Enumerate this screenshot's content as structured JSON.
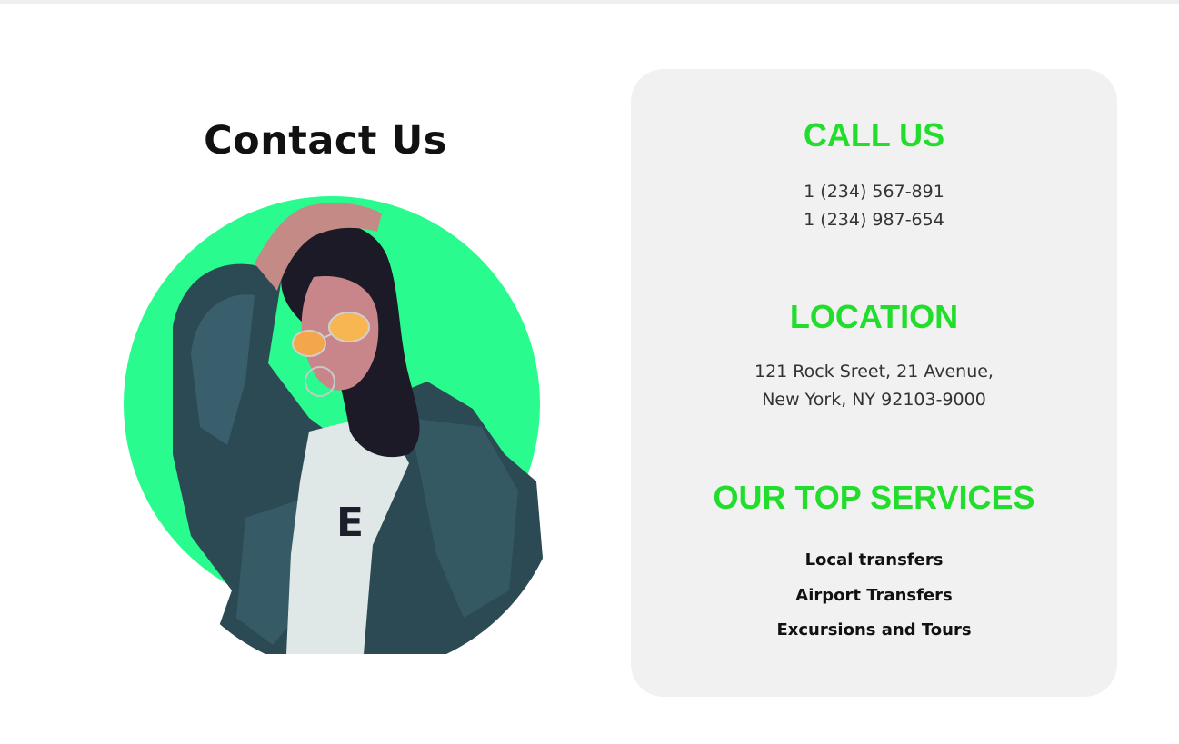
{
  "page": {
    "heading": "Contact Us",
    "accent_color": "#22dd2b",
    "circle_color": "#29fb8f",
    "card_background": "#f1f1f1"
  },
  "contact_card": {
    "call": {
      "title": "CALL US",
      "phones": [
        "1 (234) 567-891",
        "1 (234) 987-654"
      ]
    },
    "location": {
      "title": "LOCATION",
      "address_lines": [
        "121 Rock Sreet, 21 Avenue,",
        "New York, NY 92103-9000"
      ]
    },
    "services": {
      "title": "OUR TOP SERVICES",
      "items": [
        "Local transfers",
        "Airport Transfers",
        "Excursions and Tours"
      ]
    }
  }
}
